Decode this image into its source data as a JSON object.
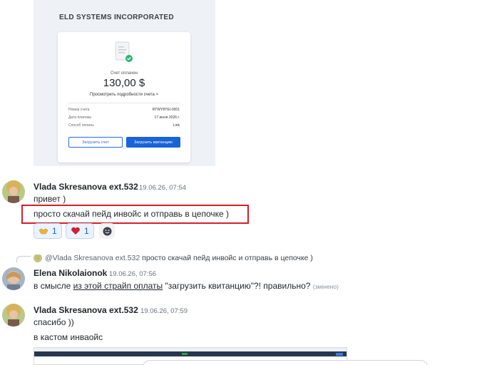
{
  "invoice": {
    "company": "ELD SYSTEMS INCORPORATED",
    "paid_label": "Счет оплачен",
    "amount": "130,00 $",
    "details_link": "Просмотреть подробности счета >",
    "rows": [
      {
        "label": "Номер счета",
        "value": "RTWY8YEI-0001"
      },
      {
        "label": "Дата платежа",
        "value": "17 июня 2026 г."
      },
      {
        "label": "Способ оплаты",
        "value": "Link"
      }
    ],
    "download_invoice_label": "Загрузить счет",
    "download_receipt_label": "Загрузить квитанцию",
    "accent": "#1a63d8"
  },
  "messages": [
    {
      "author": "Vlada Skresanova ext.532",
      "time": "19.06.26, 07:54",
      "lines": [
        "привет )",
        "просто скачай пейд инвойс и отправь в цепочке )"
      ],
      "reactions": [
        {
          "icon": "handshake-emoji",
          "count": "1"
        },
        {
          "icon": "heart-emoji",
          "count": "1"
        }
      ]
    },
    {
      "reply_to": {
        "mention": "@Vlada Skresanova ext.532",
        "text": "просто скачай пейд инвойс и отправь в цепочке )"
      },
      "author": "Elena Nikolaionok",
      "time": "19.06.26, 07:56",
      "text_before": "в смысле ",
      "link_text": "из этой страйп оплаты",
      "text_after": " \"загрузить квитанцию\"?! правильно?",
      "edited": "(змінено)"
    },
    {
      "author": "Vlada Skresanova ext.532",
      "time": "19.06.26, 07:59",
      "lines": [
        "спасибо ))",
        "в кастом инваойс"
      ]
    }
  ],
  "highlight_color": "#d32027"
}
